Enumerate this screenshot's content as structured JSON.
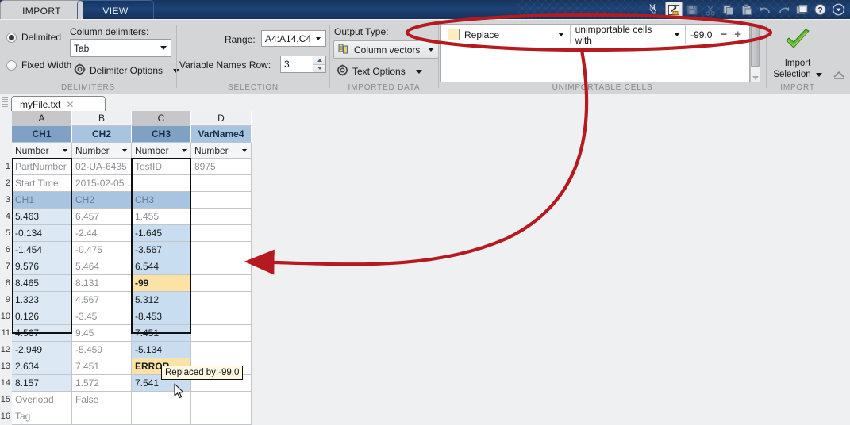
{
  "window": {
    "quick_access_icons": [
      "matlab-logo",
      "open-file-icon",
      "save-icon",
      "cut-icon",
      "copy-icon",
      "paste-icon",
      "undo-icon",
      "redo-icon",
      "layout-icon",
      "help-icon",
      "dropdown-icon"
    ]
  },
  "ribbon": {
    "tabs": [
      {
        "label": "IMPORT",
        "active": true
      },
      {
        "label": "VIEW",
        "active": false
      }
    ],
    "delimiters": {
      "group_label": "DELIMITERS",
      "radio_delimited": "Delimited",
      "radio_fixed_width": "Fixed Width",
      "selected_radio": "Delimited",
      "column_delimiters_label": "Column delimiters:",
      "column_delimiters_value": "Tab",
      "delimiter_options_label": "Delimiter Options"
    },
    "selection": {
      "group_label": "SELECTION",
      "range_label": "Range:",
      "range_value": "A4:A14,C4:...",
      "variable_names_row_label": "Variable Names Row:",
      "variable_names_row_value": "3"
    },
    "imported_data": {
      "group_label": "IMPORTED DATA",
      "output_type_label": "Output Type:",
      "output_type_value": "Column vectors",
      "text_options_label": "Text Options"
    },
    "unimportable_cells": {
      "group_label": "UNIMPORTABLE CELLS",
      "rule_action": "Replace",
      "rule_target": "unimportable cells with",
      "rule_value": "-99.0",
      "minus_label": "−",
      "plus_label": "+"
    },
    "import": {
      "group_label": "IMPORT",
      "button_line1": "Import",
      "button_line2": "Selection"
    }
  },
  "document_tab": {
    "filename": "myFile.txt",
    "close_label": "✕"
  },
  "sheet": {
    "column_letters": [
      "A",
      "B",
      "C",
      "D"
    ],
    "column_selected": [
      true,
      false,
      true,
      false
    ],
    "variable_names": [
      "CH1",
      "CH2",
      "CH3",
      "VarName4"
    ],
    "type_row": [
      "Number",
      "Number",
      "Number",
      "Number"
    ],
    "row_numbers": [
      "1",
      "2",
      "3",
      "4",
      "5",
      "6",
      "7",
      "8",
      "9",
      "10",
      "11",
      "12",
      "13",
      "14",
      "15",
      "16"
    ],
    "rows": [
      {
        "n": "1",
        "cells": [
          {
            "v": "PartNumber",
            "s": "meta"
          },
          {
            "v": "02-UA-6435",
            "s": "meta"
          },
          {
            "v": "TestID",
            "s": "meta"
          },
          {
            "v": "8975",
            "s": "meta"
          }
        ]
      },
      {
        "n": "2",
        "cells": [
          {
            "v": "Start Time",
            "s": "meta"
          },
          {
            "v": "2015-02-05 ...",
            "s": "meta"
          },
          {
            "v": "",
            "s": "meta"
          },
          {
            "v": "",
            "s": "meta"
          }
        ]
      },
      {
        "n": "3",
        "cells": [
          {
            "v": "CH1",
            "s": "hdrrow"
          },
          {
            "v": "CH2",
            "s": "hdrrow"
          },
          {
            "v": "CH3",
            "s": "hdrrow"
          },
          {
            "v": "",
            "s": "blank"
          }
        ]
      },
      {
        "n": "4",
        "cells": [
          {
            "v": "5.463",
            "s": "selA"
          },
          {
            "v": "6.457",
            "s": "plain"
          },
          {
            "v": "1.455",
            "s": "plain"
          },
          {
            "v": "",
            "s": "blank"
          }
        ]
      },
      {
        "n": "5",
        "cells": [
          {
            "v": "-0.134",
            "s": "selA"
          },
          {
            "v": "-2.44",
            "s": "plain"
          },
          {
            "v": "-1.645",
            "s": "selC"
          },
          {
            "v": "",
            "s": "blank"
          }
        ]
      },
      {
        "n": "6",
        "cells": [
          {
            "v": "-1.454",
            "s": "selA"
          },
          {
            "v": "-0.475",
            "s": "plain"
          },
          {
            "v": "-3.567",
            "s": "selC"
          },
          {
            "v": "",
            "s": "blank"
          }
        ]
      },
      {
        "n": "7",
        "cells": [
          {
            "v": "9.576",
            "s": "selA"
          },
          {
            "v": "5.464",
            "s": "plain"
          },
          {
            "v": "6.544",
            "s": "selC"
          },
          {
            "v": "",
            "s": "blank"
          }
        ]
      },
      {
        "n": "8",
        "cells": [
          {
            "v": "8.465",
            "s": "selA"
          },
          {
            "v": "8.131",
            "s": "plain"
          },
          {
            "v": "-99",
            "s": "bad"
          },
          {
            "v": "",
            "s": "blank"
          }
        ]
      },
      {
        "n": "9",
        "cells": [
          {
            "v": "1.323",
            "s": "selA"
          },
          {
            "v": "4.567",
            "s": "plain"
          },
          {
            "v": "5.312",
            "s": "selC"
          },
          {
            "v": "",
            "s": "blank"
          }
        ]
      },
      {
        "n": "10",
        "cells": [
          {
            "v": "0.126",
            "s": "selA"
          },
          {
            "v": "-3.45",
            "s": "plain"
          },
          {
            "v": "-8.453",
            "s": "selC"
          },
          {
            "v": "",
            "s": "blank"
          }
        ]
      },
      {
        "n": "11",
        "cells": [
          {
            "v": "4.567",
            "s": "selA"
          },
          {
            "v": "9.45",
            "s": "plain"
          },
          {
            "v": "7.451",
            "s": "selC"
          },
          {
            "v": "",
            "s": "blank"
          }
        ]
      },
      {
        "n": "12",
        "cells": [
          {
            "v": "-2.949",
            "s": "selA"
          },
          {
            "v": "-5.459",
            "s": "plain"
          },
          {
            "v": "-5.134",
            "s": "selC"
          },
          {
            "v": "",
            "s": "blank"
          }
        ]
      },
      {
        "n": "13",
        "cells": [
          {
            "v": "2.634",
            "s": "selA"
          },
          {
            "v": "7.451",
            "s": "plain"
          },
          {
            "v": "ERROR",
            "s": "bad"
          },
          {
            "v": "",
            "s": "blank"
          }
        ]
      },
      {
        "n": "14",
        "cells": [
          {
            "v": "8.157",
            "s": "selA"
          },
          {
            "v": "1.572",
            "s": "plain"
          },
          {
            "v": "7.541",
            "s": "selC"
          },
          {
            "v": "",
            "s": "blank"
          }
        ]
      },
      {
        "n": "15",
        "cells": [
          {
            "v": "Overload",
            "s": "meta"
          },
          {
            "v": "False",
            "s": "meta"
          },
          {
            "v": "",
            "s": "plain"
          },
          {
            "v": "",
            "s": "blank"
          }
        ]
      },
      {
        "n": "16",
        "cells": [
          {
            "v": "Tag",
            "s": "meta"
          },
          {
            "v": "",
            "s": "meta"
          },
          {
            "v": "",
            "s": "plain"
          },
          {
            "v": "",
            "s": "blank"
          }
        ]
      }
    ]
  },
  "tooltip": {
    "text": "Replaced by:-99.0"
  },
  "annotations": {
    "ellipse_target": "unimportable-cells-rule",
    "arrow_target": "replaced-by-tooltip",
    "color": "#b51a20"
  },
  "colors": {
    "accent_blue": "#1d4277",
    "selected_cell": "#dce9f5",
    "unimportable_cell": "#fbe3a8",
    "header_blue": "#a8c4e0",
    "annotation_red": "#b51a20"
  }
}
